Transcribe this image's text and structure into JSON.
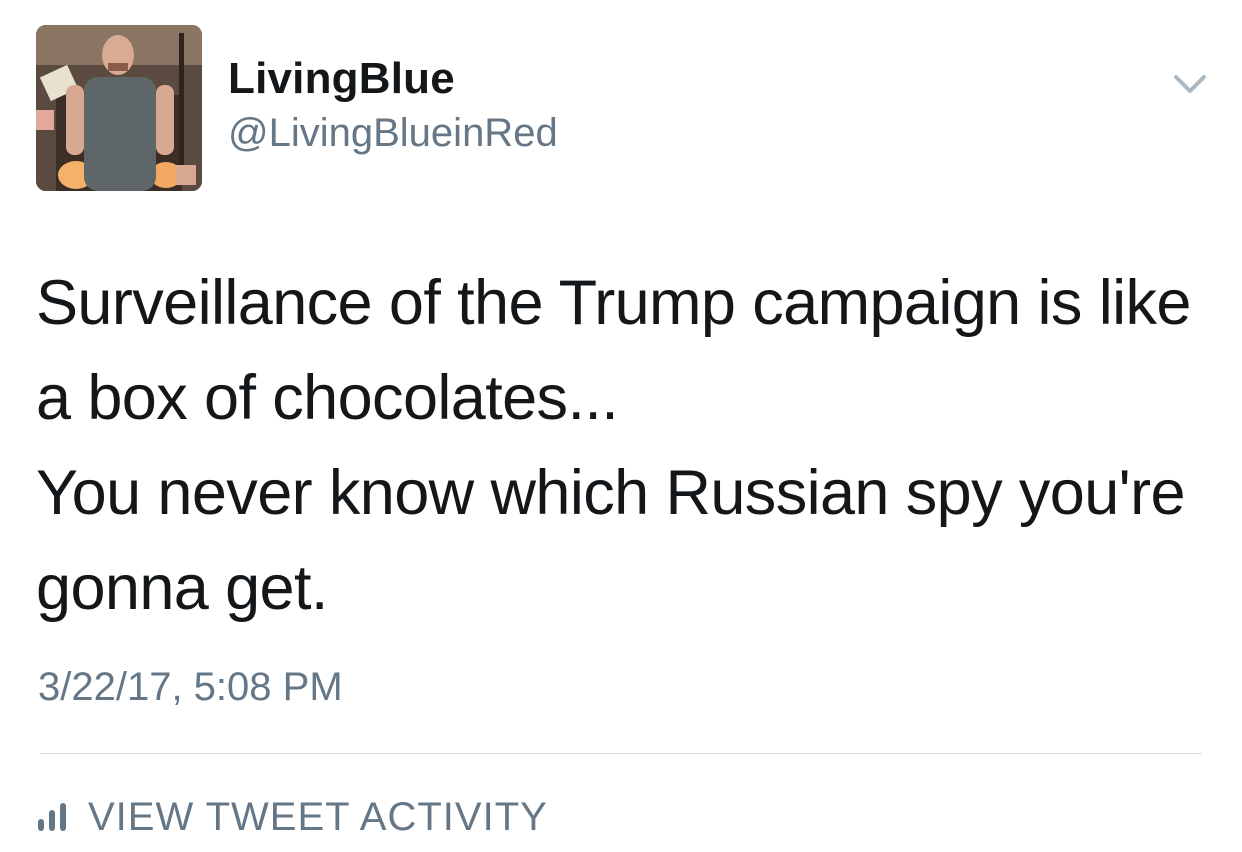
{
  "author": {
    "display_name": "LivingBlue",
    "handle": "@LivingBlueinRed",
    "avatar_icon": "profile-photo"
  },
  "tweet": {
    "text": "Surveillance of the Trump campaign is like\na box of chocolates...\nYou never know which Russian spy you're\ngonna get.",
    "timestamp": "3/22/17, 5:08 PM"
  },
  "actions": {
    "menu_icon": "chevron-down-icon",
    "activity_icon": "bar-chart-icon",
    "activity_label": "VIEW TWEET ACTIVITY"
  },
  "colors": {
    "text_primary": "#14171a",
    "text_secondary": "#657786",
    "divider": "#d8dde2",
    "background": "#ffffff"
  }
}
